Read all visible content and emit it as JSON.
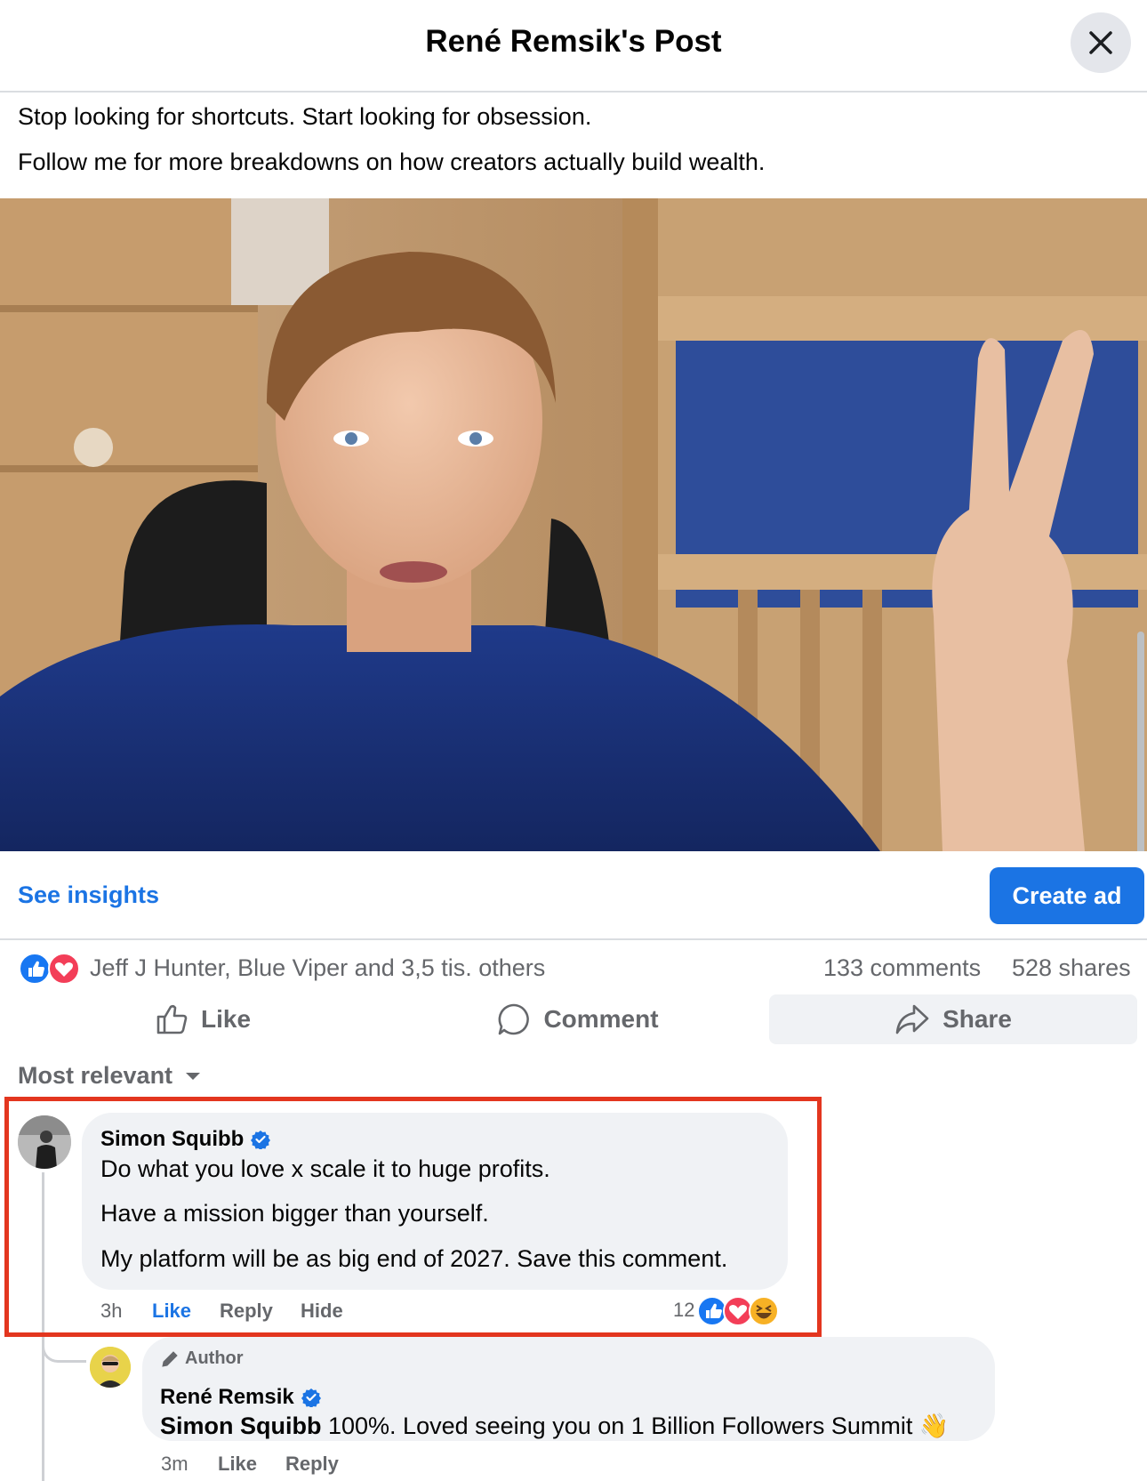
{
  "header": {
    "title": "René Remsik's Post"
  },
  "post": {
    "text_lines": [
      "Stop looking for shortcuts. Start looking for obsession.",
      "Follow me for more breakdowns on how creators actually build wealth."
    ]
  },
  "insights": {
    "see_insights_label": "See insights",
    "create_ad_label": "Create ad"
  },
  "reactions_summary": {
    "names_text": "Jeff J Hunter, Blue Viper and 3,5 tis. others",
    "comments": "133 comments",
    "shares": "528 shares",
    "icons": [
      "like-icon",
      "love-icon"
    ]
  },
  "actions": {
    "like": "Like",
    "comment": "Comment",
    "share": "Share"
  },
  "sort": {
    "label": "Most relevant"
  },
  "comments": [
    {
      "author": "Simon Squibb",
      "verified": true,
      "lines": [
        "Do what you love x scale it to huge profits.",
        "Have a mission bigger than yourself.",
        "My platform will be as big end of 2027. Save this comment."
      ],
      "time": "3h",
      "like_label": "Like",
      "reply_label": "Reply",
      "hide_label": "Hide",
      "reaction_count": "12",
      "reaction_icons": [
        "like-icon",
        "love-icon",
        "haha-icon"
      ],
      "highlight_color": "#e3361f",
      "replies": [
        {
          "badge": "Author",
          "author": "René Remsik",
          "verified": true,
          "mention": "Simon Squibb",
          "text": " 100%. Loved seeing you on 1 Billion Followers Summit",
          "emoji": "👋",
          "time": "3m",
          "like_label": "Like",
          "reply_label": "Reply"
        }
      ]
    }
  ],
  "colors": {
    "accent": "#1b74e4",
    "secondary_text": "#65676b",
    "bubble": "#f0f2f5"
  }
}
